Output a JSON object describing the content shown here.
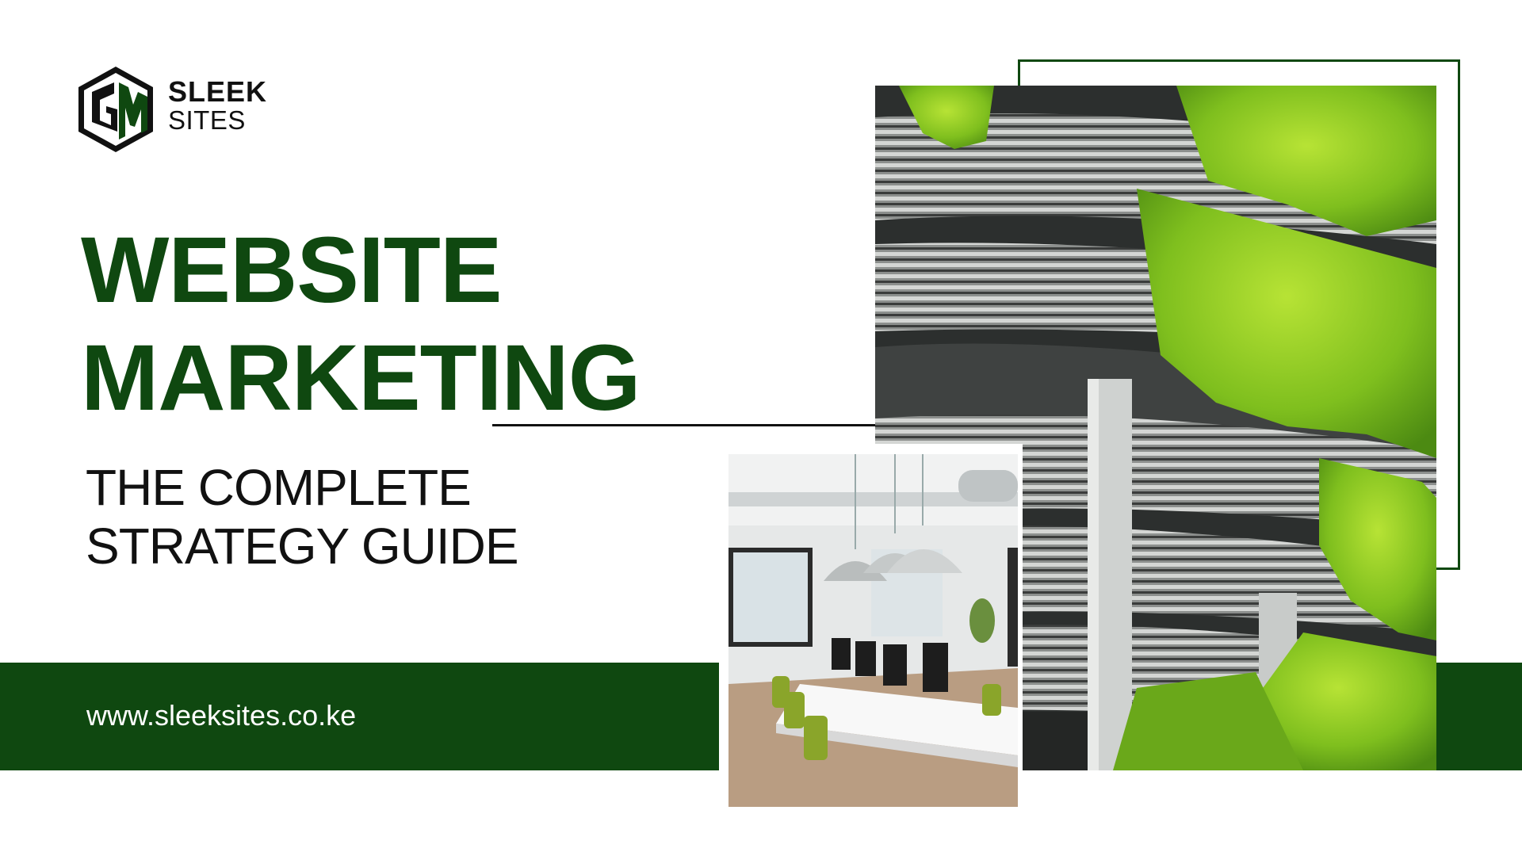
{
  "brand": {
    "line1": "SLEEK",
    "line2": "SITES",
    "logo_icon": "gm-hexagon-logo",
    "color": "#0f4810"
  },
  "headline": {
    "line1": "WEBSITE",
    "line2": "MARKETING"
  },
  "subheadline": {
    "line1": "THE COMPLETE",
    "line2": "STRATEGY GUIDE"
  },
  "footer": {
    "url": "www.sleeksites.co.ke"
  },
  "images": {
    "main_photo": "green-wall-building-photo",
    "inset_photo": "office-interior-photo"
  },
  "colors": {
    "accent": "#0f4810",
    "background": "#ffffff"
  }
}
